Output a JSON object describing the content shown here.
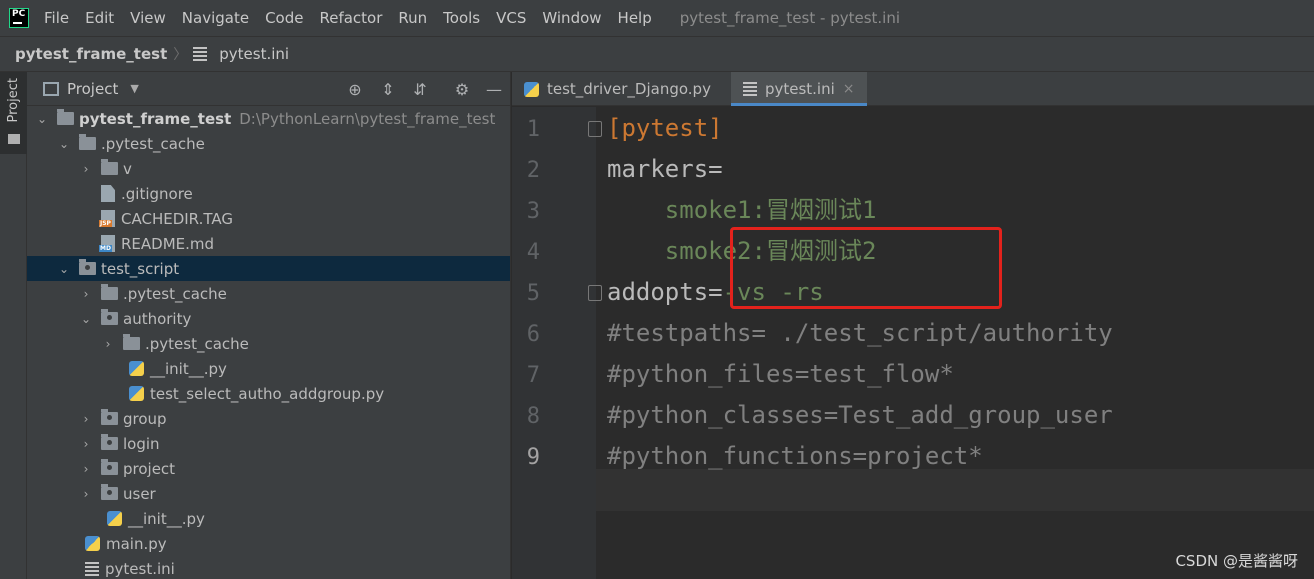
{
  "menubar": {
    "items": [
      "File",
      "Edit",
      "View",
      "Navigate",
      "Code",
      "Refactor",
      "Run",
      "Tools",
      "VCS",
      "Window",
      "Help"
    ],
    "window_title": "pytest_frame_test - pytest.ini",
    "logo_text": "PC"
  },
  "breadcrumb": {
    "project": "pytest_frame_test",
    "separator": "〉",
    "file": "pytest.ini"
  },
  "tool_strip": {
    "project_label": "Project"
  },
  "project_panel": {
    "title": "Project",
    "dropdown": "▼",
    "tools": {
      "locate": "⊕",
      "expand": "⇕",
      "collapse": "⇵",
      "settings": "⚙",
      "hide": "—"
    }
  },
  "tree": [
    {
      "label": "pytest_frame_test",
      "path": "D:\\PythonLearn\\pytest_frame_test",
      "arrow": "⌄",
      "icon": "folder"
    },
    {
      "label": ".pytest_cache",
      "arrow": "⌄",
      "icon": "folder"
    },
    {
      "label": "v",
      "arrow": "›",
      "icon": "folder"
    },
    {
      "label": ".gitignore",
      "arrow": "",
      "icon": "git"
    },
    {
      "label": "CACHEDIR.TAG",
      "arrow": "",
      "icon": "tag"
    },
    {
      "label": "README.md",
      "arrow": "",
      "icon": "md"
    },
    {
      "label": "test_script",
      "arrow": "⌄",
      "icon": "folder-src",
      "selected": true
    },
    {
      "label": ".pytest_cache",
      "arrow": "›",
      "icon": "folder"
    },
    {
      "label": "authority",
      "arrow": "⌄",
      "icon": "folder-src"
    },
    {
      "label": ".pytest_cache",
      "arrow": "›",
      "icon": "folder"
    },
    {
      "label": "__init__.py",
      "arrow": "",
      "icon": "py"
    },
    {
      "label": "test_select_autho_addgroup.py",
      "arrow": "",
      "icon": "py"
    },
    {
      "label": "group",
      "arrow": "›",
      "icon": "folder-src"
    },
    {
      "label": "login",
      "arrow": "›",
      "icon": "folder-src"
    },
    {
      "label": "project",
      "arrow": "›",
      "icon": "folder-src"
    },
    {
      "label": "user",
      "arrow": "›",
      "icon": "folder-src"
    },
    {
      "label": "__init__.py",
      "arrow": "",
      "icon": "py"
    },
    {
      "label": "main.py",
      "arrow": "",
      "icon": "py"
    },
    {
      "label": "pytest.ini",
      "arrow": "",
      "icon": "ini"
    }
  ],
  "tabs": [
    {
      "label": "test_driver_Django.py",
      "active": false,
      "close": ""
    },
    {
      "label": "pytest.ini",
      "active": true,
      "close": "×"
    }
  ],
  "editor": {
    "line_numbers": [
      "1",
      "2",
      "3",
      "4",
      "5",
      "6",
      "7",
      "8",
      "9"
    ],
    "current_line": 9,
    "lines": [
      [
        {
          "t": "[pytest]",
          "c": "section"
        }
      ],
      [
        {
          "t": "markers=",
          "c": "key"
        }
      ],
      [
        {
          "t": "    smoke1:冒烟测试1",
          "c": "val"
        }
      ],
      [
        {
          "t": "    smoke2:冒烟测试2",
          "c": "val"
        }
      ],
      [
        {
          "t": "addopts",
          "c": "key underline"
        },
        {
          "t": "=",
          "c": "eq"
        },
        {
          "t": "-vs -rs",
          "c": "val"
        }
      ],
      [
        {
          "t": "#testpaths= ./test_script/authority",
          "c": "comment"
        }
      ],
      [
        {
          "t": "#python_files=test_flow*",
          "c": "comment"
        }
      ],
      [
        {
          "t": "#python_classes=Test_add_group_user",
          "c": "comment"
        }
      ],
      [
        {
          "t": "#python_functions=project*",
          "c": "comment"
        }
      ]
    ]
  },
  "watermark": "CSDN @是酱酱呀"
}
